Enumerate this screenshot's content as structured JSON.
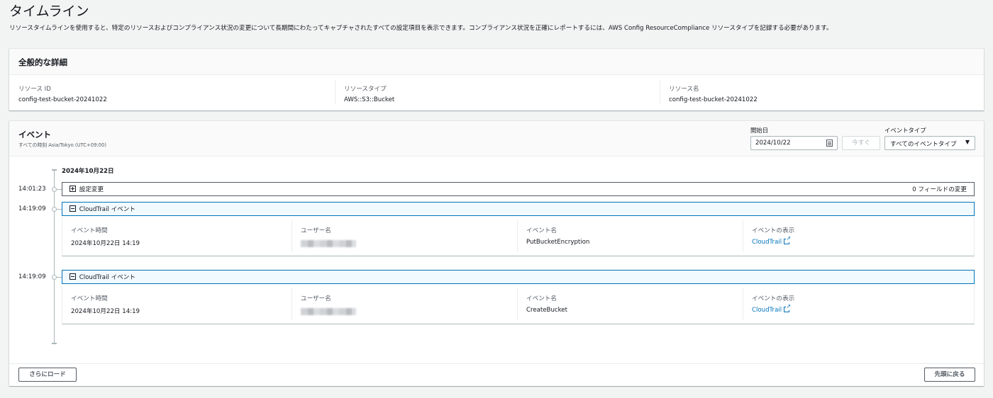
{
  "page": {
    "title": "タイムライン",
    "description": "リソースタイムラインを使用すると、特定のリソースおよびコンプライアンス状況の変更について長期間にわたってキャプチャされたすべての設定項目を表示できます。コンプライアンス状況を正確にレポートするには、AWS Config ResourceCompliance リソースタイプを記録する必要があります。"
  },
  "details": {
    "title": "全般的な詳細",
    "items": [
      {
        "label": "リソース ID",
        "value": "config-test-bucket-20241022"
      },
      {
        "label": "リソースタイプ",
        "value": "AWS::S3::Bucket"
      },
      {
        "label": "リソース名",
        "value": "config-test-bucket-20241022"
      }
    ]
  },
  "events": {
    "title": "イベント",
    "timezone": "すべての時刻 Asia/Tokyo (UTC+09:00)",
    "start_date_label": "開始日",
    "start_date_value": "2024/10/22",
    "now_label": "今すぐ",
    "event_type_label": "イベントタイプ",
    "event_type_value": "すべてのイベントタイプ",
    "date_heading": "2024年10月22日",
    "entries": [
      {
        "time": "14:01:23",
        "title": "設定変更",
        "right_text": "0 フィールドの変更"
      },
      {
        "time": "14:19:09",
        "title": "CloudTrail イベント",
        "details": [
          {
            "label": "イベント時間",
            "value": "2024年10月22日 14:19"
          },
          {
            "label": "ユーザー名",
            "value": ""
          },
          {
            "label": "イベント名",
            "value": "PutBucketEncryption"
          },
          {
            "label": "イベントの表示",
            "value": "CloudTrail"
          }
        ]
      },
      {
        "time": "14:19:09",
        "title": "CloudTrail イベント",
        "details": [
          {
            "label": "イベント時間",
            "value": "2024年10月22日 14:19"
          },
          {
            "label": "ユーザー名",
            "value": ""
          },
          {
            "label": "イベント名",
            "value": "CreateBucket"
          },
          {
            "label": "イベントの表示",
            "value": "CloudTrail"
          }
        ]
      }
    ],
    "load_more_label": "さらにロード",
    "back_to_top_label": "先頭に戻る"
  },
  "colors": {
    "link": "#0073bb",
    "active_border": "#0073bb",
    "background": "#f2f3f3"
  }
}
